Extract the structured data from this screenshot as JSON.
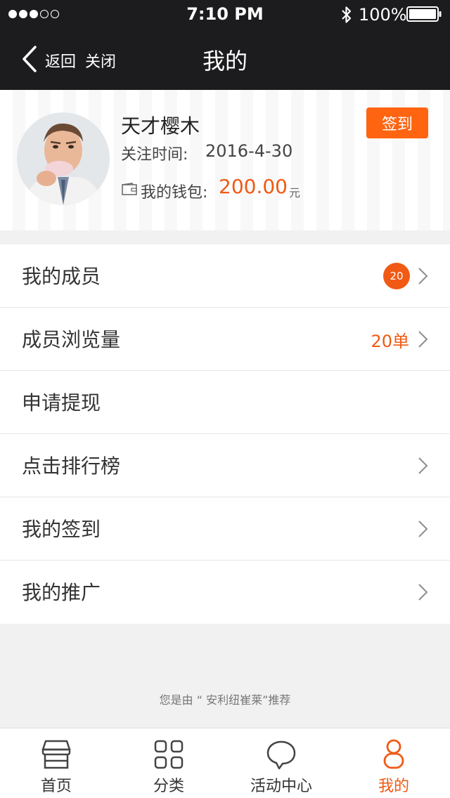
{
  "colors": {
    "accent": "#f05a14",
    "checkin_bg": "#ff6411",
    "topbar_bg": "#1c1c1e"
  },
  "status_bar": {
    "time": "7:10 PM",
    "battery": "100%",
    "signal_dots_filled": 3,
    "signal_dots_total": 5
  },
  "navbar": {
    "back_label": "返回",
    "close_label": "关闭",
    "title": "我的"
  },
  "profile": {
    "name": "天才樱木",
    "follow_label": "关注时间:",
    "follow_date": "2016-4-30",
    "wallet_label": "我的钱包:",
    "wallet_amount": "200.00",
    "wallet_unit": "元",
    "checkin_label": "签到"
  },
  "menu": {
    "items": [
      {
        "label": "我的成员",
        "badge": "20",
        "chevron": true
      },
      {
        "label": "成员浏览量",
        "value": "20单",
        "chevron": true
      },
      {
        "label": "申请提现",
        "chevron": false
      },
      {
        "label": "点击排行榜",
        "chevron": true
      },
      {
        "label": "我的签到",
        "chevron": true
      },
      {
        "label": "我的推广",
        "chevron": true
      }
    ]
  },
  "footer_note": "您是由 “ 安利纽崔莱”推荐",
  "tabbar": {
    "tabs": [
      {
        "label": "首页",
        "icon": "store-icon"
      },
      {
        "label": "分类",
        "icon": "grid-icon"
      },
      {
        "label": "活动中心",
        "icon": "chat-bubble-icon"
      },
      {
        "label": "我的",
        "icon": "person-icon",
        "active": true
      }
    ]
  }
}
